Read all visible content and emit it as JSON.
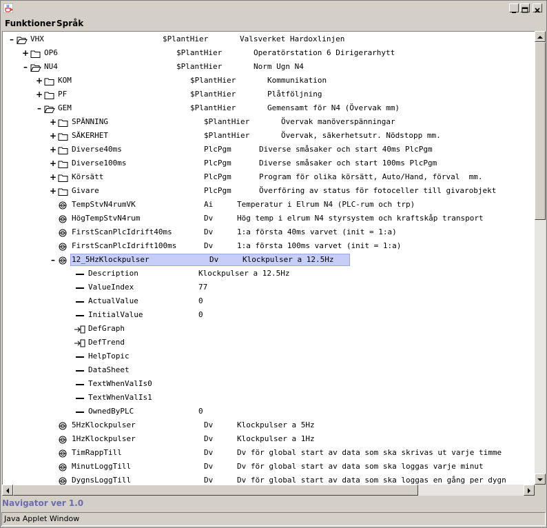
{
  "menu": {
    "functions": "Funktioner",
    "language": "Språk"
  },
  "tree": [
    {
      "indent": 0,
      "toggle": "–",
      "icon": "folder-open-icon",
      "name": "VHX",
      "cls": "$PlantHier",
      "desc": "Valsverket Hardoxlinjen"
    },
    {
      "indent": 1,
      "toggle": "+",
      "icon": "folder-icon",
      "name": "OP6",
      "cls": "$PlantHier",
      "desc": "Operatörstation 6 Dirigerarhytt"
    },
    {
      "indent": 1,
      "toggle": "–",
      "icon": "folder-open-icon",
      "name": "NU4",
      "cls": "$PlantHier",
      "desc": "Norm Ugn N4"
    },
    {
      "indent": 2,
      "toggle": "+",
      "icon": "folder-icon",
      "name": "KOM",
      "cls": "$PlantHier",
      "desc": "Kommunikation"
    },
    {
      "indent": 2,
      "toggle": "+",
      "icon": "folder-icon",
      "name": "PF",
      "cls": "$PlantHier",
      "desc": "Plåtföljning"
    },
    {
      "indent": 2,
      "toggle": "–",
      "icon": "folder-open-icon",
      "name": "GEM",
      "cls": "$PlantHier",
      "desc": "Gemensamt för N4 (Övervak mm)"
    },
    {
      "indent": 3,
      "toggle": "+",
      "icon": "folder-icon",
      "name": "SPÄNNING",
      "cls": "$PlantHier",
      "desc": "Övervak manöverspänningar"
    },
    {
      "indent": 3,
      "toggle": "+",
      "icon": "folder-icon",
      "name": "SÄKERHET",
      "cls": "$PlantHier",
      "desc": "Övervak, säkerhetsutr. Nödstopp mm."
    },
    {
      "indent": 3,
      "toggle": "+",
      "icon": "folder-icon",
      "name": "Diverse40ms",
      "cls": "PlcPgm",
      "desc": "Diverse småsaker och start 40ms PlcPgm"
    },
    {
      "indent": 3,
      "toggle": "+",
      "icon": "folder-icon",
      "name": "Diverse100ms",
      "cls": "PlcPgm",
      "desc": "Diverse småsaker och start 100ms PlcPgm"
    },
    {
      "indent": 3,
      "toggle": "+",
      "icon": "folder-icon",
      "name": "Körsätt",
      "cls": "PlcPgm",
      "desc": "Program för olika körsätt, Auto/Hand, förval  mm."
    },
    {
      "indent": 3,
      "toggle": "+",
      "icon": "folder-icon",
      "name": "Givare",
      "cls": "PlcPgm",
      "desc": "Överföring av status för fotoceller till givarobjekt"
    },
    {
      "indent": 3,
      "toggle": "",
      "icon": "signal-icon",
      "name": "TempStvN4rumVK",
      "cls": "Ai",
      "desc": "Temperatur i Elrum N4 (PLC-rum och trp)"
    },
    {
      "indent": 3,
      "toggle": "",
      "icon": "signal-icon",
      "name": "HögTempStvN4rum",
      "cls": "Dv",
      "desc": "Hög temp i elrum N4 styrsystem och kraftskåp transport"
    },
    {
      "indent": 3,
      "toggle": "",
      "icon": "signal-icon",
      "name": "FirstScanPlcIdrift40ms",
      "cls": "Dv",
      "desc": "1:a första 40ms varvet (init = 1:a)"
    },
    {
      "indent": 3,
      "toggle": "",
      "icon": "signal-icon",
      "name": "FirstScanPlcIdrift100ms",
      "cls": "Dv",
      "desc": "1:a första 100ms varvet (init = 1:a)"
    },
    {
      "indent": 3,
      "toggle": "–",
      "icon": "signal-icon",
      "name": "12_5HzKlockpulser",
      "cls": "Dv",
      "desc": "Klockpulser a 12.5Hz",
      "selected": true
    },
    {
      "indent": 4,
      "toggle": "",
      "icon": "attribute-icon",
      "name": "Description",
      "cls": "",
      "desc": "Klockpulser a 12.5Hz"
    },
    {
      "indent": 4,
      "toggle": "",
      "icon": "attribute-icon",
      "name": "ValueIndex",
      "cls": "",
      "desc": "77"
    },
    {
      "indent": 4,
      "toggle": "",
      "icon": "attribute-icon",
      "name": "ActualValue",
      "cls": "",
      "desc": "0"
    },
    {
      "indent": 4,
      "toggle": "",
      "icon": "attribute-icon",
      "name": "InitialValue",
      "cls": "",
      "desc": "0"
    },
    {
      "indent": 4,
      "toggle": "",
      "icon": "link-icon",
      "name": "DefGraph",
      "cls": "",
      "desc": ""
    },
    {
      "indent": 4,
      "toggle": "",
      "icon": "link-icon",
      "name": "DefTrend",
      "cls": "",
      "desc": ""
    },
    {
      "indent": 4,
      "toggle": "",
      "icon": "attribute-icon",
      "name": "HelpTopic",
      "cls": "",
      "desc": ""
    },
    {
      "indent": 4,
      "toggle": "",
      "icon": "attribute-icon",
      "name": "DataSheet",
      "cls": "",
      "desc": ""
    },
    {
      "indent": 4,
      "toggle": "",
      "icon": "attribute-icon",
      "name": "TextWhenValIs0",
      "cls": "",
      "desc": ""
    },
    {
      "indent": 4,
      "toggle": "",
      "icon": "attribute-icon",
      "name": "TextWhenValIs1",
      "cls": "",
      "desc": ""
    },
    {
      "indent": 4,
      "toggle": "",
      "icon": "attribute-icon",
      "name": "OwnedByPLC",
      "cls": "",
      "desc": "0"
    },
    {
      "indent": 3,
      "toggle": "",
      "icon": "signal-icon",
      "name": "5HzKlockpulser",
      "cls": "Dv",
      "desc": "Klockpulser a 5Hz"
    },
    {
      "indent": 3,
      "toggle": "",
      "icon": "signal-icon",
      "name": "1HzKlockpulser",
      "cls": "Dv",
      "desc": "Klockpulser a 1Hz"
    },
    {
      "indent": 3,
      "toggle": "",
      "icon": "signal-icon",
      "name": "TimRappTill",
      "cls": "Dv",
      "desc": "Dv för global start av data som ska skrivas ut varje timme"
    },
    {
      "indent": 3,
      "toggle": "",
      "icon": "signal-icon",
      "name": "MinutLoggTill",
      "cls": "Dv",
      "desc": "Dv för global start av data som ska loggas varje minut"
    },
    {
      "indent": 3,
      "toggle": "",
      "icon": "signal-icon",
      "name": "DygnsLoggTill",
      "cls": "Dv",
      "desc": "Dv för global start av data som ska loggas en gång per dygn"
    }
  ],
  "status": "Navigator ver 1.0",
  "applet_bar": "Java Applet Window"
}
